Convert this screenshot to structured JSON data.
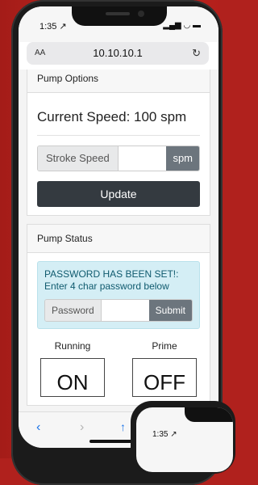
{
  "status": {
    "time": "1:35 ↗",
    "icons": "▂▄▆ ◡ ▬"
  },
  "browser": {
    "aa": "AA",
    "url": "10.10.10.1",
    "reload": "↻"
  },
  "pump_options": {
    "header": "Pump Options",
    "current_speed": "Current Speed: 100 spm",
    "stroke_label": "Stroke Speed",
    "stroke_value": "",
    "unit": "spm",
    "update_label": "Update"
  },
  "pump_status": {
    "header": "Pump Status",
    "alert_text": "PASSWORD HAS BEEN SET!: Enter 4 char password below",
    "password_label": "Password",
    "submit_label": "Submit",
    "running_label": "Running",
    "running_state": "ON",
    "prime_label": "Prime",
    "prime_state": "OFF"
  },
  "toolbar": {
    "back": "‹",
    "forward": "›",
    "share": "↑"
  },
  "second_phone": {
    "time": "1:35 ↗"
  }
}
